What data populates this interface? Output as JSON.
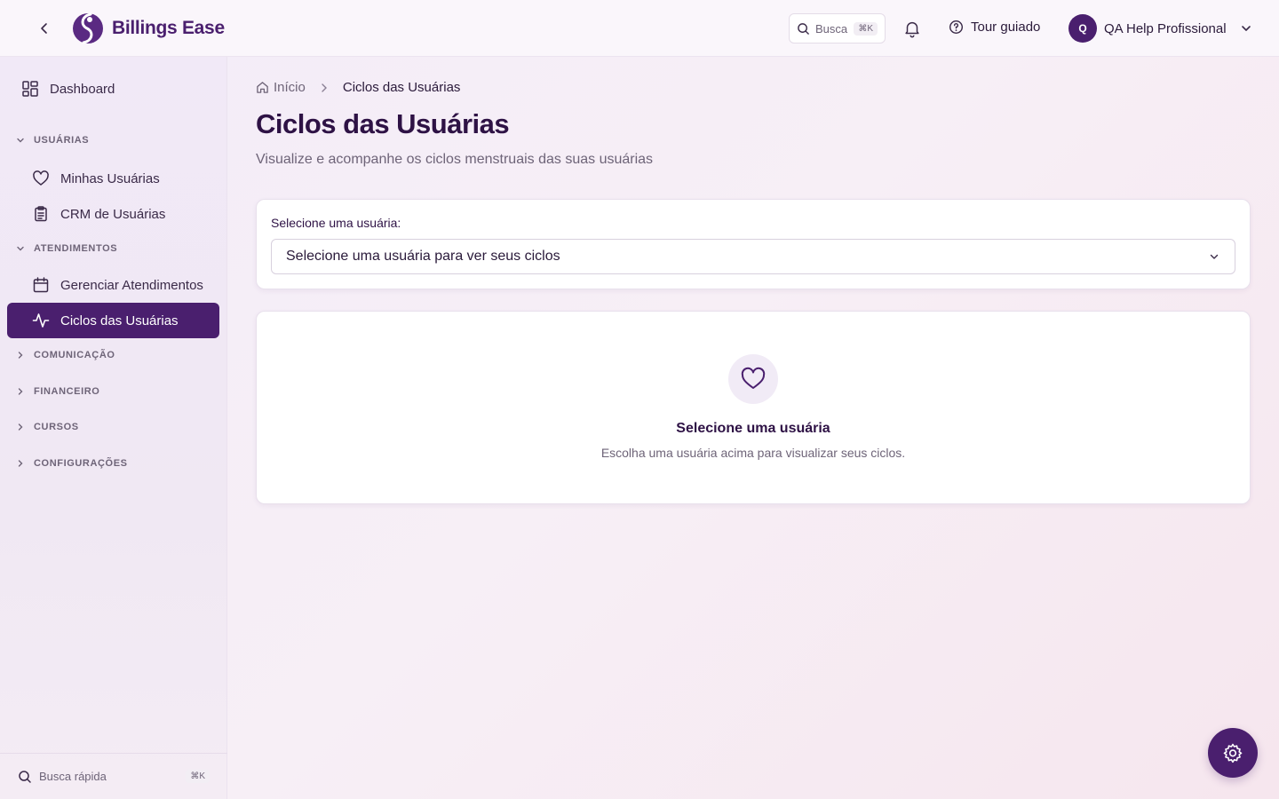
{
  "app": {
    "name": "Billings Ease"
  },
  "header": {
    "search_label": "Busca",
    "search_shortcut": "⌘K",
    "tour_label": "Tour guiado",
    "user_initial": "Q",
    "user_name": "QA Help Profissional"
  },
  "sidebar": {
    "dashboard": "Dashboard",
    "sections": {
      "usuarias": "USUÁRIAS",
      "atendimentos": "ATENDIMENTOS",
      "comunicacao": "COMUNICAÇÃO",
      "financeiro": "FINANCEIRO",
      "cursos": "CURSOS",
      "configuracoes": "CONFIGURAÇÕES"
    },
    "items": {
      "minhas_usuarias": "Minhas Usuárias",
      "crm_usuarias": "CRM de Usuárias",
      "gerenciar_atendimentos": "Gerenciar Atendimentos",
      "ciclos_usuarias": "Ciclos das Usuárias"
    },
    "quick_search_label": "Busca rápida",
    "quick_search_shortcut": "⌘K"
  },
  "breadcrumb": {
    "home": "Início",
    "current": "Ciclos das Usuárias"
  },
  "page": {
    "title": "Ciclos das Usuárias",
    "subtitle": "Visualize e acompanhe os ciclos menstruais das suas usuárias"
  },
  "selector": {
    "label": "Selecione uma usuária:",
    "value": "Selecione uma usuária para ver seus ciclos"
  },
  "empty_state": {
    "title": "Selecione uma usuária",
    "description": "Escolha uma usuária acima para visualizar seus ciclos."
  },
  "colors": {
    "accent": "#4a1f6e",
    "muted_text": "#6e6478"
  }
}
